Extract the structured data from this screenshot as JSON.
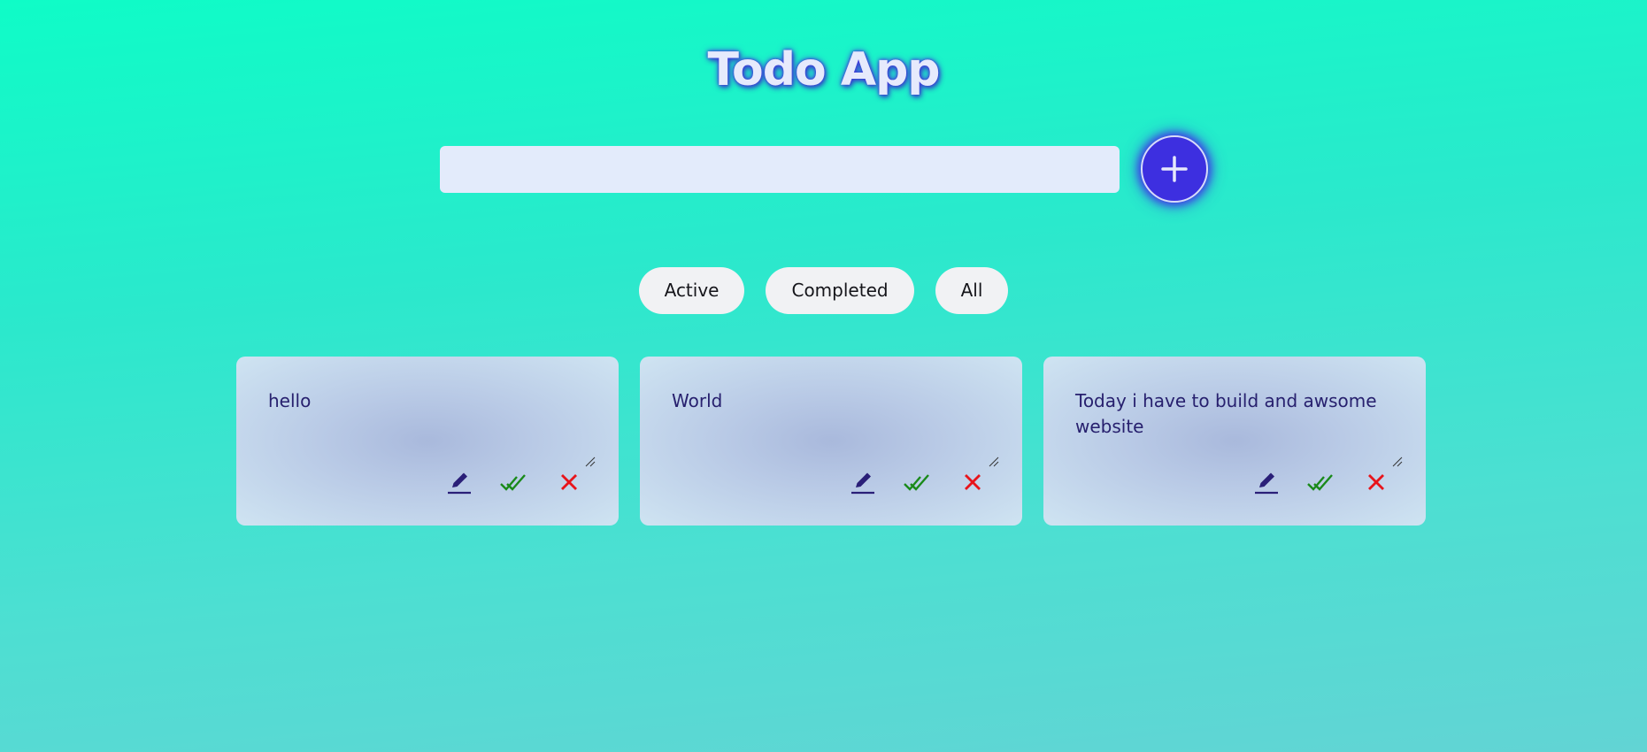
{
  "app": {
    "title": "Todo App"
  },
  "input": {
    "value": "",
    "placeholder": ""
  },
  "add_button": {
    "icon": "plus-icon"
  },
  "filters": [
    {
      "label": "Active"
    },
    {
      "label": "Completed"
    },
    {
      "label": "All"
    }
  ],
  "todos": [
    {
      "text": "hello"
    },
    {
      "text": "World"
    },
    {
      "text": "Today i have to build and awsome website"
    }
  ],
  "icons": {
    "edit": "pen-icon",
    "complete": "double-check-icon",
    "delete": "x-icon",
    "resize": "resize-handle-icon"
  },
  "colors": {
    "accent": "#3d2fe0",
    "text": "#27206e",
    "complete": "#1a8a1a",
    "delete": "#e8141b",
    "filter_bg": "#f1f2f4"
  }
}
